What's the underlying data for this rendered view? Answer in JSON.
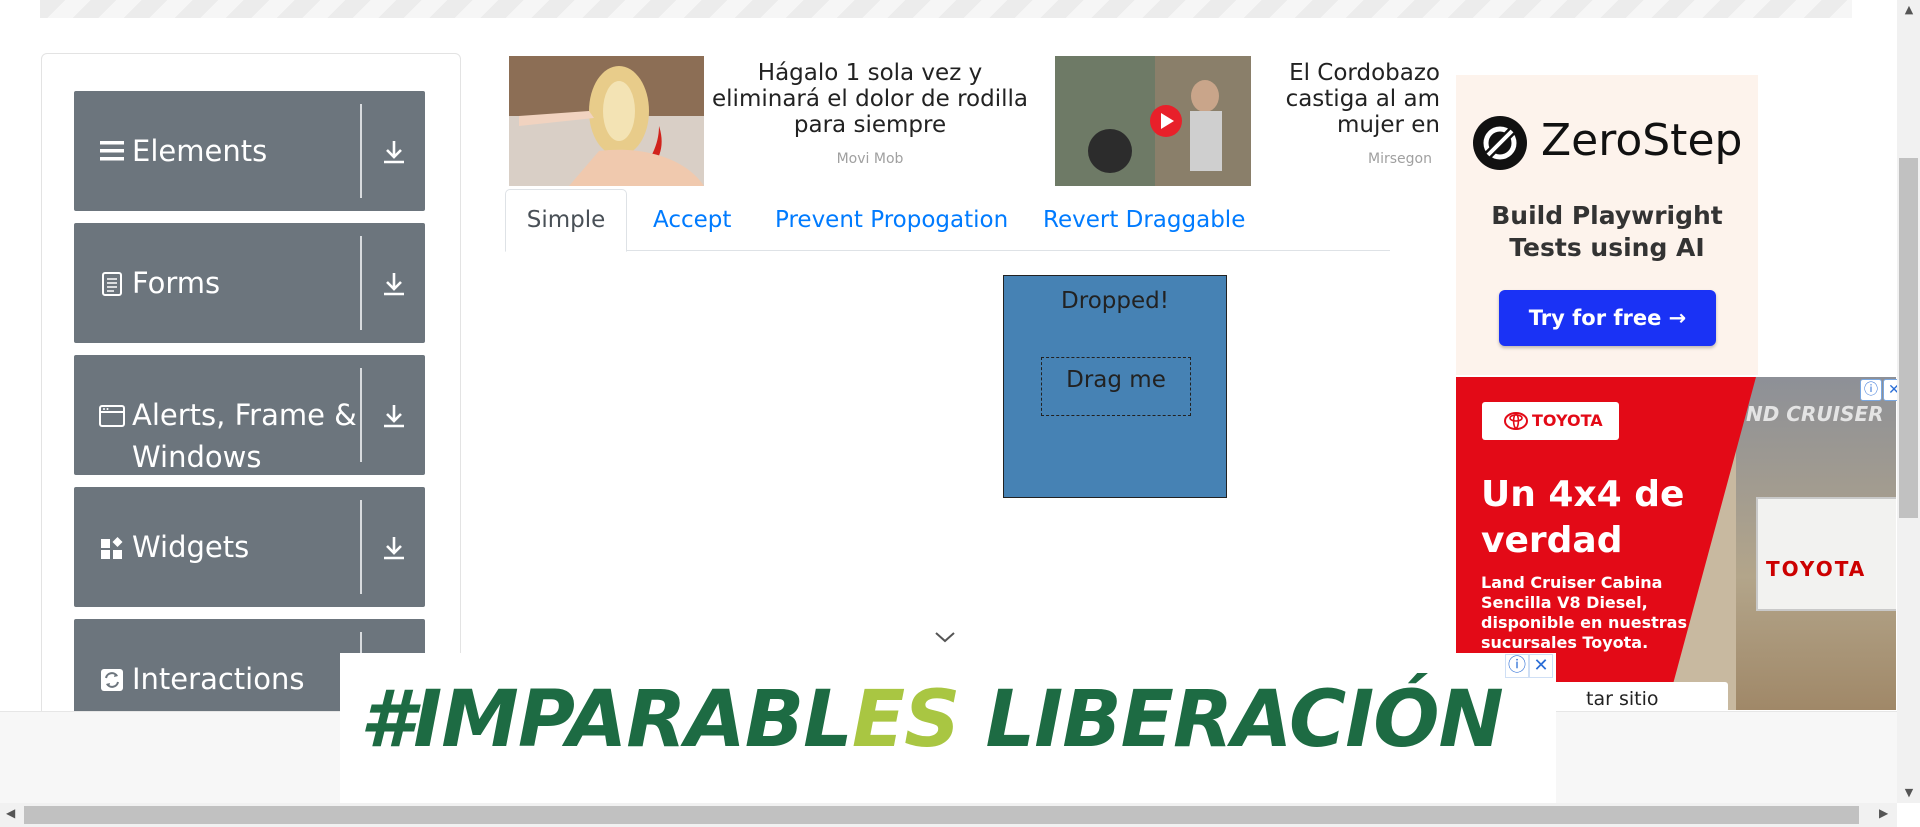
{
  "sidebar": {
    "groups": [
      {
        "label": "Elements",
        "icon": "menu-icon"
      },
      {
        "label": "Forms",
        "icon": "document-icon"
      },
      {
        "label": "Alerts, Frame &",
        "label2": "Windows",
        "icon": "window-icon"
      },
      {
        "label": "Widgets",
        "icon": "widgets-icon"
      },
      {
        "label": "Interactions",
        "icon": "interactions-icon"
      }
    ]
  },
  "ads": {
    "knee": {
      "title_1": "Hágalo 1 sola vez y",
      "title_2": "eliminará el dolor de rodilla",
      "title_3": "para siempre",
      "source": "Movi Mob"
    },
    "cordobazo": {
      "title_1": "El Cordobazo",
      "title_2": "castiga al am",
      "title_3": "mujer en",
      "source": "Mirsegon"
    },
    "zerostep": {
      "logo": "ZeroStep",
      "tagline_1": "Build Playwright",
      "tagline_2": "Tests using AI",
      "cta": "Try for free →"
    },
    "toyota": {
      "badge": "TOYOTA",
      "overlay": "ND CRUISER",
      "headline_1": "Un 4x4 de",
      "headline_2": "verdad",
      "subtext": "Land Cruiser Cabina Sencilla V8 Diesel, disponible en nuestras sucursales Toyota.",
      "visit": "tar sitio",
      "truck_brand": "TOYOTA"
    },
    "banner": {
      "text_1": "#IMPARABL",
      "text_es": "ES",
      "text_2": " LIBERACIÓN"
    }
  },
  "tabs": [
    {
      "label": "Simple",
      "active": true
    },
    {
      "label": "Accept",
      "active": false
    },
    {
      "label": "Prevent Propogation",
      "active": false
    },
    {
      "label": "Revert Draggable",
      "active": false
    }
  ],
  "droppable": {
    "text": "Dropped!",
    "draggable_text": "Drag me"
  },
  "colors": {
    "sidebar_group": "#6c757d",
    "drop_target": "#4682b4",
    "tab_link": "#007bff",
    "zerostep_button": "#1a32f5",
    "toyota_red": "#e30a17",
    "banner_green": "#1d6b43"
  }
}
